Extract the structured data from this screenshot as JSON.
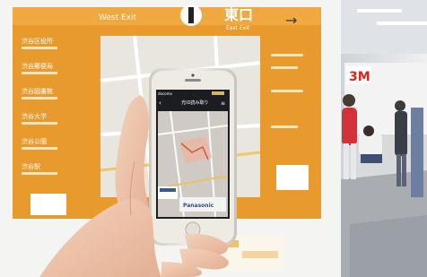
{
  "sign": {
    "west_exit": "West Exit",
    "east_exit_jp": "東口",
    "east_exit_en": "East Exit",
    "left_labels": [
      "渋谷区役所",
      "渋谷郵便局",
      "渋谷図書館",
      "渋谷大学",
      "渋谷公園",
      "渋谷駅"
    ]
  },
  "phone": {
    "screen_title": "光ID読み取り",
    "carrier": "docomo",
    "brand": "Panasonic"
  },
  "booth": {
    "logo": "3M"
  },
  "colors": {
    "sign_orange": "#e99a2c",
    "map_base": "#e8e6df",
    "phone_body": "#e9e6df"
  }
}
